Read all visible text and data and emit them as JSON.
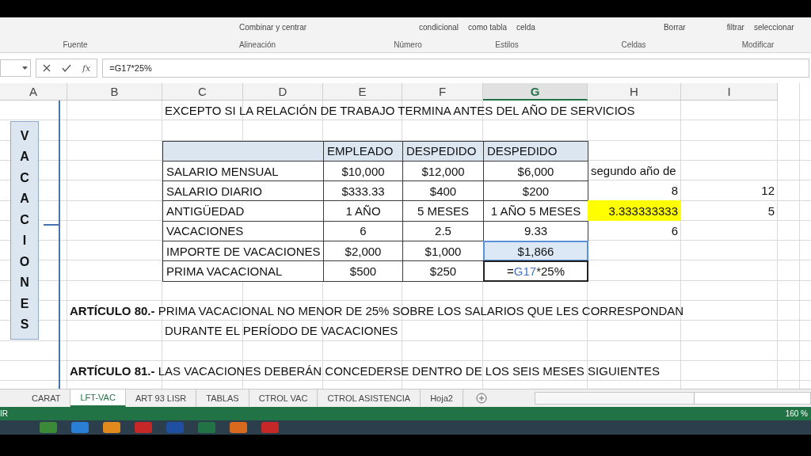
{
  "ribbon": {
    "commands": [
      "Combinar y centrar",
      "condicional",
      "como tabla",
      "celda",
      "Borrar",
      "filtrar",
      "seleccionar"
    ],
    "group_labels": [
      "Fuente",
      "Alineación",
      "Número",
      "Estilos",
      "Celdas",
      "Modificar"
    ]
  },
  "formula_bar": {
    "fx": "fx",
    "formula": "=G17*25%"
  },
  "columns": [
    {
      "label": "A",
      "selected": false
    },
    {
      "label": "B",
      "selected": false
    },
    {
      "label": "C",
      "selected": false
    },
    {
      "label": "D",
      "selected": false
    },
    {
      "label": "E",
      "selected": false
    },
    {
      "label": "F",
      "selected": false
    },
    {
      "label": "G",
      "selected": true
    },
    {
      "label": "H",
      "selected": false
    },
    {
      "label": "I",
      "selected": false
    }
  ],
  "vertical_label": "VACACIONES",
  "heading": "EXCEPTO SI LA RELACIÓN DE TRABAJO TERMINA ANTES DEL AÑO DE SERVICIOS",
  "table": {
    "headers": [
      "EMPLEADO",
      "DESPEDIDO",
      "DESPEDIDO"
    ],
    "rows": [
      {
        "label": "SALARIO MENSUAL",
        "values": [
          "$10,000",
          "$12,000",
          "$6,000"
        ],
        "side": [
          {
            "text": "segundo año de",
            "kind": "text",
            "highlight": false
          }
        ]
      },
      {
        "label": "SALARIO DIARIO",
        "values": [
          "$333.33",
          "$400",
          "$200"
        ],
        "side": [
          {
            "text": "8",
            "kind": "number",
            "highlight": false
          },
          {
            "text": "12",
            "kind": "number",
            "highlight": false
          }
        ]
      },
      {
        "label": "ANTIGÜEDAD",
        "values": [
          "1 AÑO",
          "5 MESES",
          "1 AÑO 5 MESES"
        ],
        "side": [
          {
            "text": "3.333333333",
            "kind": "number",
            "highlight": true
          },
          {
            "text": "5",
            "kind": "number",
            "highlight": false
          }
        ]
      },
      {
        "label": "VACACIONES",
        "values": [
          "6",
          "2.5",
          "9.33"
        ],
        "side": [
          {
            "text": "6",
            "kind": "number",
            "highlight": false
          }
        ]
      },
      {
        "label": "IMPORTE DE VACACIONES",
        "values": [
          "$2,000",
          "$1,000",
          "$1,866"
        ],
        "referenced": true,
        "side": []
      },
      {
        "label": "PRIMA VACACIONAL",
        "values": [
          "$500",
          "$250"
        ],
        "editing": [
          {
            "text": "=",
            "ref": false
          },
          {
            "text": "G17",
            "ref": true
          },
          {
            "text": "*25%",
            "ref": false
          }
        ],
        "side": []
      }
    ]
  },
  "articles": [
    {
      "title": "ARTÍCULO 80.-",
      "text": "PRIMA VACACIONAL NO MENOR DE 25% SOBRE LOS SALARIOS QUE LES CORRESPONDAN",
      "continuation": "DURANTE EL PERÍODO DE VACACIONES"
    },
    {
      "title": "ARTÍCULO 81.-",
      "text": "LAS VACACIONES DEBERÁN CONCEDERSE DENTRO DE LOS SEIS MESES SIGUIENTES"
    }
  ],
  "sheet_tabs": [
    {
      "label": "CARAT",
      "selected": false
    },
    {
      "label": "LFT-VAC",
      "selected": true
    },
    {
      "label": "ART 93 LISR",
      "selected": false
    },
    {
      "label": "TABLAS",
      "selected": false
    },
    {
      "label": "CTROL VAC",
      "selected": false
    },
    {
      "label": "CTROL ASISTENCIA",
      "selected": false
    },
    {
      "label": "Hoja2",
      "selected": false
    }
  ],
  "status_bar": {
    "mode": "IR",
    "zoom": "160 %"
  }
}
